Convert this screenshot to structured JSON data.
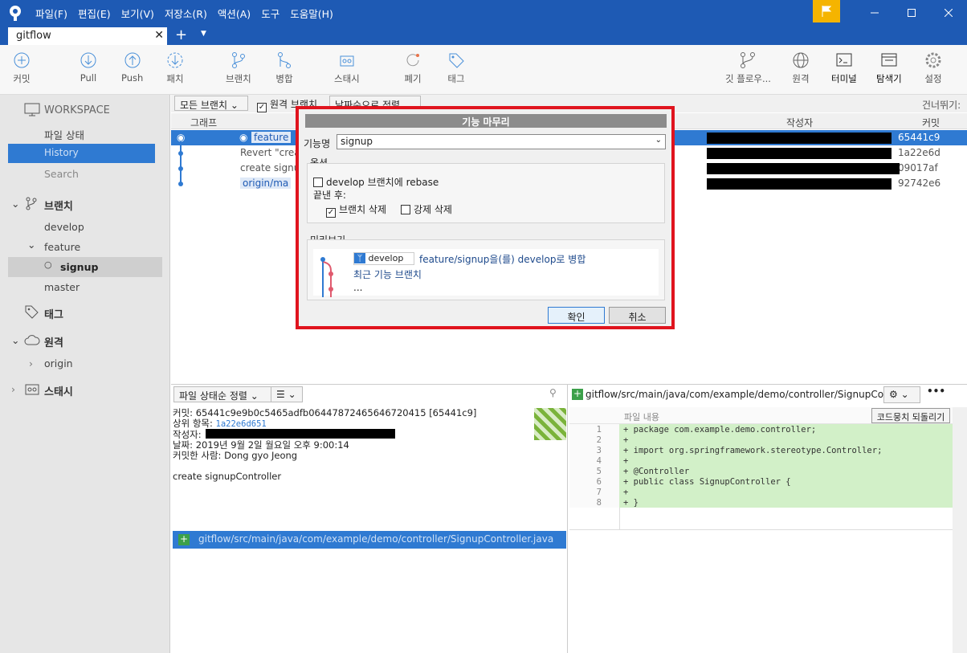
{
  "menu": [
    "파일(F)",
    "편집(E)",
    "보기(V)",
    "저장소(R)",
    "액션(A)",
    "도구",
    "도움말(H)"
  ],
  "tab": {
    "title": "gitflow"
  },
  "toolbar": {
    "commit": "커밋",
    "pull": "Pull",
    "push": "Push",
    "patch": "패치",
    "branch": "브랜치",
    "merge": "병합",
    "stash": "스태시",
    "discard": "폐기",
    "tag": "태그",
    "gitflow": "깃 플로우...",
    "remote": "원격",
    "terminal": "터미널",
    "explorer": "탐색기",
    "settings": "설정"
  },
  "sidebar": {
    "workspace": "WORKSPACE",
    "file_status": "파일 상태",
    "history": "History",
    "search": "Search",
    "branches": "브랜치",
    "develop": "develop",
    "feature": "feature",
    "signup": "signup",
    "master": "master",
    "tags": "태그",
    "remotes": "원격",
    "origin": "origin",
    "stashes": "스태시"
  },
  "filter": {
    "all_branches": "모든 브랜치",
    "remote_branches": "원격 브랜치",
    "sort": "날짜순으로 정렬",
    "skip": "건너뛰기:"
  },
  "columns": {
    "graph": "그래프",
    "author": "작성자",
    "commit": "커밋"
  },
  "commits": [
    {
      "branch": "feature",
      "message": "",
      "hash": "65441c9"
    },
    {
      "branch": "",
      "message": "Revert \"creat",
      "hash": "1a22e6d"
    },
    {
      "branch": "",
      "message": "create signup",
      "hash": "09017af"
    },
    {
      "branch": "origin/ma",
      "message": "",
      "hash": "92742e6"
    }
  ],
  "dialog": {
    "title": "기능 마무리",
    "feature_label": "기능명",
    "feature_value": "signup",
    "options_label": "옵션",
    "rebase": "develop 브랜치에 rebase",
    "after": "끝낸 후:",
    "delete_branch": "브랜치 삭제",
    "force_delete": "강제 삭제",
    "preview_label": "미리보기",
    "preview_branch": "develop",
    "preview_merge": "feature/signup을(를) develop로 병합",
    "preview_recent": "최근 기능 브랜치",
    "preview_more": "...",
    "ok": "확인",
    "cancel": "취소"
  },
  "files": {
    "sort": "파일 상태순 정렬",
    "path": "gitflow/src/main/java/com/example/demo/controller/SignupController.java"
  },
  "details": {
    "commit_line": "커밋: 65441c9e9b0c5465adfb06447872465646720415 [65441c9]",
    "parent_label": "상위 항목:",
    "parent": "1a22e6d651",
    "author_label": "작성자:",
    "date": "날짜: 2019년 9월 2일 월요일 오후 9:00:14",
    "committer": "커밋한 사람: Dong gyo Jeong",
    "message": "create signupController"
  },
  "diff": {
    "header": "gitflow/src/main/java/com/example/demo/controller/SignupContro...",
    "file_content": "파일 내용",
    "revert": "코드뭉치 되돌리기",
    "lines": [
      {
        "n": "1",
        "t": "+ package com.example.demo.controller;"
      },
      {
        "n": "2",
        "t": "+"
      },
      {
        "n": "3",
        "t": "+ import org.springframework.stereotype.Controller;"
      },
      {
        "n": "4",
        "t": "+"
      },
      {
        "n": "5",
        "t": "+ @Controller"
      },
      {
        "n": "6",
        "t": "+ public class SignupController {"
      },
      {
        "n": "7",
        "t": "+"
      },
      {
        "n": "8",
        "t": "+ }"
      }
    ]
  }
}
